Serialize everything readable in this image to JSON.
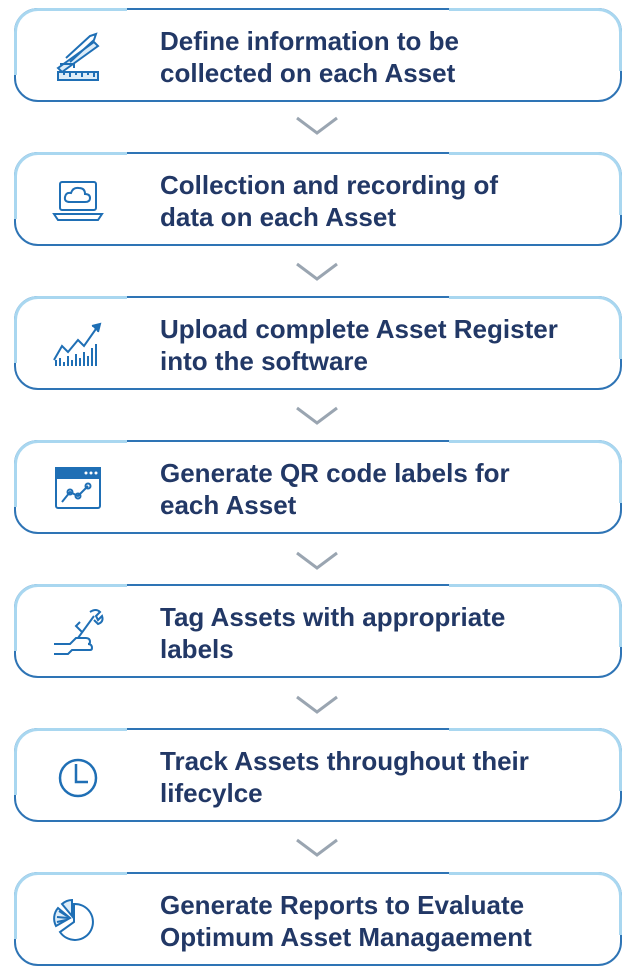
{
  "steps": [
    {
      "icon": "ruler-pencil-icon",
      "text": "Define information to be\ncollected on each Asset"
    },
    {
      "icon": "laptop-cloud-icon",
      "text": "Collection and recording of\ndata on each Asset"
    },
    {
      "icon": "growth-chart-icon",
      "text": "Upload complete Asset Register\ninto the software"
    },
    {
      "icon": "browser-graph-icon",
      "text": "Generate QR code labels for\neach Asset"
    },
    {
      "icon": "hand-wrench-icon",
      "text": "Tag Assets with appropriate\nlabels"
    },
    {
      "icon": "clock-icon",
      "text": "Track Assets throughout their\nlifecylce"
    },
    {
      "icon": "pie-chart-icon",
      "text": "Generate Reports to Evaluate\nOptimum Asset Managaement"
    }
  ],
  "colors": {
    "border": "#2e74b5",
    "border_highlight": "#a9d7f0",
    "text": "#223866",
    "icon": "#1f6fb5",
    "chevron": "#9aa5b1"
  }
}
